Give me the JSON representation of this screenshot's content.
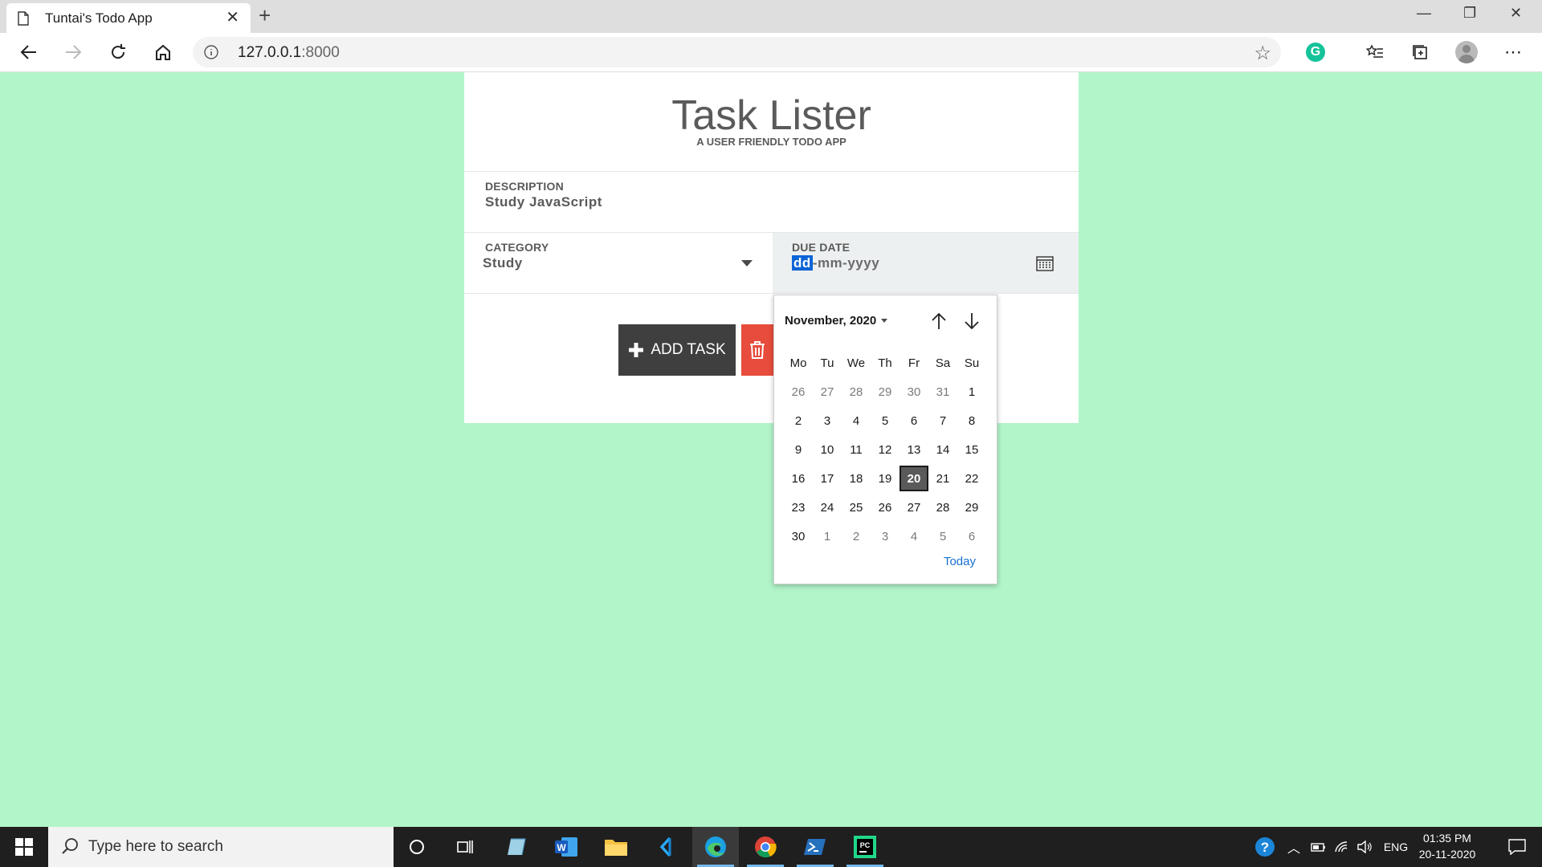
{
  "browser": {
    "tab_title": "Tuntai's Todo App",
    "url_host": "127.0.0.1",
    "url_port": ":8000"
  },
  "app": {
    "title": "Task Lister",
    "subtitle": "A USER FRIENDLY TODO APP",
    "description_label": "DESCRIPTION",
    "description_value": "Study JavaScript",
    "category_label": "CATEGORY",
    "category_value": "Study",
    "due_label": "DUE DATE",
    "due_dd": "dd",
    "due_rest": "-mm-yyyy",
    "add_button": "ADD TASK"
  },
  "picker": {
    "month_label": "November, 2020",
    "weekdays": [
      "Mo",
      "Tu",
      "We",
      "Th",
      "Fr",
      "Sa",
      "Su"
    ],
    "weeks": [
      [
        "26",
        "27",
        "28",
        "29",
        "30",
        "31",
        "1"
      ],
      [
        "2",
        "3",
        "4",
        "5",
        "6",
        "7",
        "8"
      ],
      [
        "9",
        "10",
        "11",
        "12",
        "13",
        "14",
        "15"
      ],
      [
        "16",
        "17",
        "18",
        "19",
        "20",
        "21",
        "22"
      ],
      [
        "23",
        "24",
        "25",
        "26",
        "27",
        "28",
        "29"
      ],
      [
        "30",
        "1",
        "2",
        "3",
        "4",
        "5",
        "6"
      ]
    ],
    "selected_day": "20",
    "today_link": "Today"
  },
  "taskbar": {
    "search_placeholder": "Type here to search",
    "lang": "ENG",
    "time": "01:35 PM",
    "date": "20-11-2020"
  },
  "colors": {
    "page_bg": "#b2f5c9",
    "add_button": "#3f3f3f",
    "delete_button": "#e74c3c",
    "selection": "#0a64d6"
  }
}
